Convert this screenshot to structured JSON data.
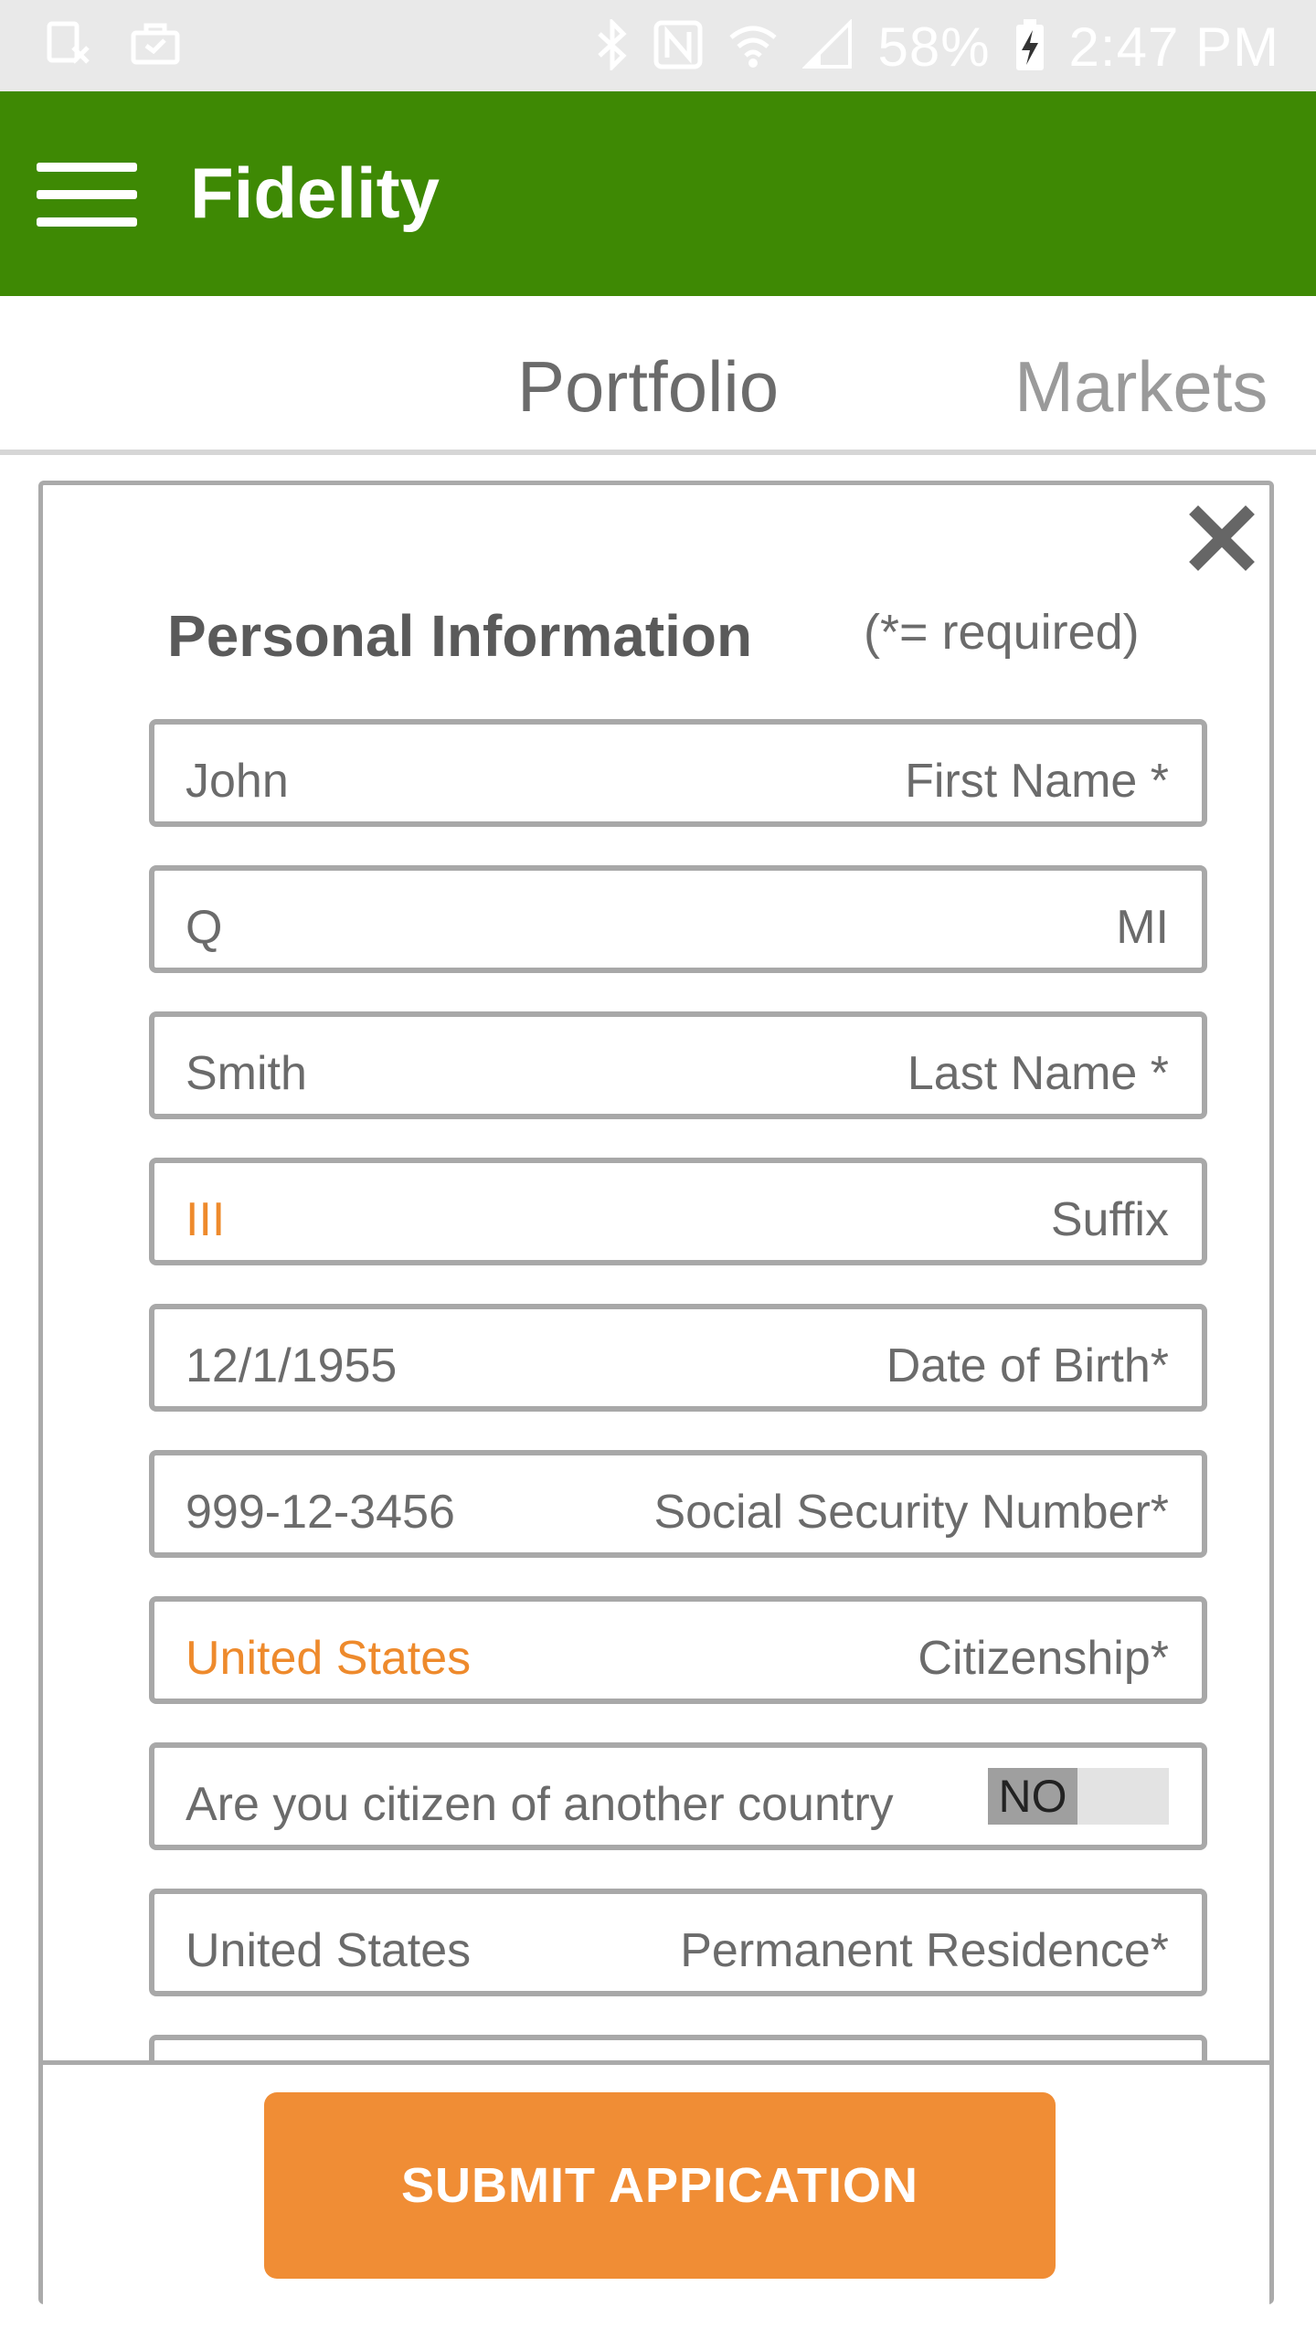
{
  "status_bar": {
    "battery": "58%",
    "time": "2:47 PM",
    "left_icons": [
      "sim-icon",
      "briefcase-icon"
    ],
    "right_icons": [
      "bluetooth-icon",
      "nfc-icon",
      "wifi-icon",
      "signal-icon",
      "battery-charging-icon"
    ]
  },
  "app_bar": {
    "title": "Fidelity"
  },
  "tabs": [
    {
      "label": "Portfolio"
    },
    {
      "label": "Markets"
    }
  ],
  "dialog": {
    "title": "Personal Information",
    "required_note": "(*= required)",
    "fields": [
      {
        "value": "John",
        "label": "First Name *"
      },
      {
        "value": "Q",
        "label": "MI"
      },
      {
        "value": "Smith",
        "label": "Last Name *"
      },
      {
        "value": "III",
        "label": "Suffix"
      },
      {
        "value": "12/1/1955",
        "label": "Date of Birth*"
      },
      {
        "value": "999-12-3456",
        "label": "Social Security Number*"
      },
      {
        "value": "United States",
        "label": "Citizenship*"
      },
      {
        "value": "Are you citizen of another country",
        "label": "NO"
      },
      {
        "value": "United States",
        "label": "Permanent Residence*"
      }
    ],
    "submit_label": "SUBMIT APPICATION"
  },
  "colors": {
    "brand_green": "#3e8904",
    "accent_orange": "#f08d35",
    "selected_value": "#ee8a2c"
  }
}
